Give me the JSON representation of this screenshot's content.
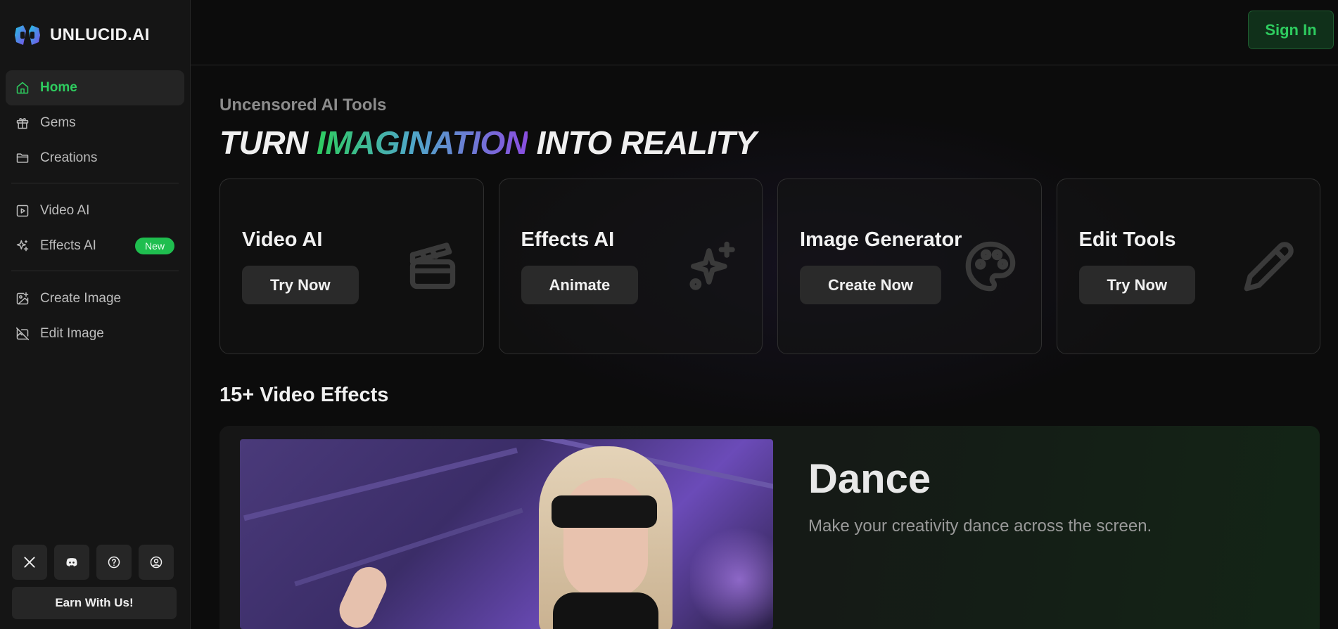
{
  "brand": {
    "name": "UNLUCID.AI",
    "colors": {
      "primary_green": "#2ecc5f",
      "logo_cyan": "#22c3e6",
      "logo_purple": "#7b4de6"
    }
  },
  "sidebar": {
    "items": [
      {
        "label": "Home",
        "icon": "home-icon",
        "active": true
      },
      {
        "label": "Gems",
        "icon": "gift-icon"
      },
      {
        "label": "Creations",
        "icon": "folder-icon"
      },
      {
        "label": "Video AI",
        "icon": "play-square-icon"
      },
      {
        "label": "Effects AI",
        "icon": "sparkles-icon",
        "badge": "New"
      },
      {
        "label": "Create Image",
        "icon": "image-plus-icon"
      },
      {
        "label": "Edit Image",
        "icon": "image-off-icon"
      }
    ],
    "social": [
      "x-icon",
      "discord-icon",
      "help-circle-icon",
      "user-circle-icon"
    ],
    "earn_label": "Earn With Us!"
  },
  "header": {
    "signin_label": "Sign In"
  },
  "hero": {
    "kicker": "Uncensored AI Tools",
    "headline_pre": "TURN ",
    "headline_highlight": "IMAGINATION",
    "headline_post": " INTO REALITY"
  },
  "cards": [
    {
      "title": "Video AI",
      "button": "Try Now",
      "icon": "clapperboard-icon"
    },
    {
      "title": "Effects AI",
      "button": "Animate",
      "icon": "sparkles-icon"
    },
    {
      "title": "Image Generator",
      "button": "Create Now",
      "icon": "palette-icon"
    },
    {
      "title": "Edit Tools",
      "button": "Try Now",
      "icon": "pencil-icon"
    }
  ],
  "effects_section": {
    "title": "15+ Video Effects",
    "featured": {
      "title": "Dance",
      "description": "Make your creativity dance across the screen."
    }
  }
}
